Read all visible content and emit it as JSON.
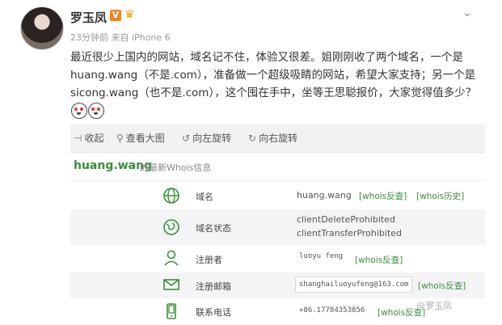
{
  "post": {
    "username": "罗玉凤",
    "badge": "V",
    "meta": "23分钟前 来自 iPhone 6",
    "content": "最近很少上国内的网站，域名记不住，体验又很差。姐刚刚收了两个域名，一个是huang.wang（不是.com），准备做一个超级吸睛的网站，希望大家支持；另一个是sicong.wang（也不是.com），这个囤在手中，坐等王思聪报价，大家觉得值多少？"
  },
  "toolbar": {
    "collapse": "收起",
    "view_large": "查看大图",
    "rotate_left": "向左旋转",
    "rotate_right": "向右旋转"
  },
  "whois": {
    "domain": "huang.wang",
    "subtitle": "的最新Whois信息",
    "rows": [
      {
        "icon": "globe-icon",
        "label": "域名",
        "value": "huang.wang",
        "links": [
          "[whois反查]",
          "[whois历史]"
        ]
      },
      {
        "icon": "globe-status-icon",
        "label": "域名状态",
        "value1": "clientDeleteProhibited",
        "value2": "clientTransferProhibited"
      },
      {
        "icon": "person-icon",
        "label": "注册者",
        "value": "luoyu feng",
        "links": [
          "[whois反查]"
        ]
      },
      {
        "icon": "mail-icon",
        "label": "注册邮箱",
        "value": "shanghailuoyufeng@163.com",
        "links": [
          "[whois反查]"
        ]
      },
      {
        "icon": "phone-icon",
        "label": "联系电话",
        "value": "+86.17784353856",
        "links": [
          "[whois反查]"
        ]
      }
    ]
  },
  "watermark": "@罗玉凤",
  "colors": {
    "accent": "#3a8f3a",
    "badge": "#f58220"
  }
}
